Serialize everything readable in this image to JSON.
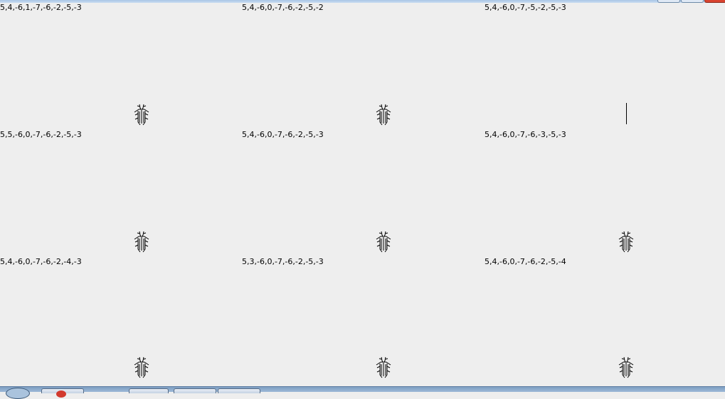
{
  "window": {
    "controls": [
      "minimize",
      "maximize",
      "close"
    ]
  },
  "panels": [
    {
      "label": "5,4,-6,1,-7,-6,-2,-5,-3",
      "sprite": "bug-icon"
    },
    {
      "label": "5,4,-6,0,-7,-6,-2,-5,-2",
      "sprite": "bug-icon"
    },
    {
      "label": "5,4,-6,0,-7,-5,-2,-5,-3",
      "sprite": "text-caret"
    },
    {
      "label": "5,5,-6,0,-7,-6,-2,-5,-3",
      "sprite": "bug-icon"
    },
    {
      "label": "5,4,-6,0,-7,-6,-2,-5,-3",
      "sprite": "bug-icon"
    },
    {
      "label": "5,4,-6,0,-7,-6,-3,-5,-3",
      "sprite": "bug-icon"
    },
    {
      "label": "5,4,-6,0,-7,-6,-2,-4,-3",
      "sprite": "bug-icon"
    },
    {
      "label": "5,3,-6,0,-7,-6,-2,-5,-3",
      "sprite": "bug-icon"
    },
    {
      "label": "5,4,-6,0,-7,-6,-2,-5,-4",
      "sprite": "bug-icon"
    }
  ],
  "taskbar": {
    "items": [
      "start-orb",
      "app-red",
      "app-1",
      "app-2",
      "app-3"
    ]
  }
}
